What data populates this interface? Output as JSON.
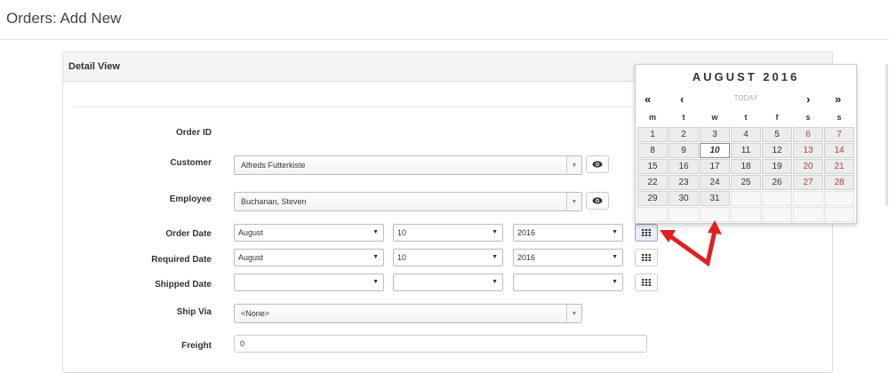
{
  "page": {
    "title": "Orders: Add New"
  },
  "panel": {
    "heading": "Detail View"
  },
  "form": {
    "order_id": {
      "label": "Order ID",
      "value": ""
    },
    "customer": {
      "label": "Customer",
      "value": "Alfreds Futterkiste"
    },
    "employee": {
      "label": "Employee",
      "value": "Buchanan, Steven"
    },
    "order_date": {
      "label": "Order Date",
      "month": "August",
      "day": "10",
      "year": "2016"
    },
    "required_date": {
      "label": "Required Date",
      "month": "August",
      "day": "10",
      "year": "2016"
    },
    "shipped_date": {
      "label": "Shipped Date",
      "month": "",
      "day": "",
      "year": ""
    },
    "ship_via": {
      "label": "Ship Via",
      "value": "<None>"
    },
    "freight": {
      "label": "Freight",
      "value": "0"
    }
  },
  "calendar": {
    "title": "AUGUST 2016",
    "nav_first": "«",
    "nav_prev": "‹",
    "today": "TODAY",
    "nav_next": "›",
    "nav_last": "»",
    "weekdays": [
      "m",
      "t",
      "w",
      "t",
      "f",
      "s",
      "s"
    ],
    "weeks": [
      [
        "1",
        "2",
        "3",
        "4",
        "5",
        "6",
        "7"
      ],
      [
        "8",
        "9",
        "10",
        "11",
        "12",
        "13",
        "14"
      ],
      [
        "15",
        "16",
        "17",
        "18",
        "19",
        "20",
        "21"
      ],
      [
        "22",
        "23",
        "24",
        "25",
        "26",
        "27",
        "28"
      ],
      [
        "29",
        "30",
        "31",
        "",
        "",
        "",
        ""
      ],
      [
        "",
        "",
        "",
        "",
        "",
        "",
        ""
      ]
    ],
    "selected_day": "10"
  },
  "icons": {
    "view": "eye-icon",
    "calendar": "calendar-grid-icon",
    "dropdown": "chevron-down-icon"
  },
  "colors": {
    "arrow": "#e02020",
    "weekend": "#b04040",
    "panel_heading_bg": "#f5f5f5"
  }
}
